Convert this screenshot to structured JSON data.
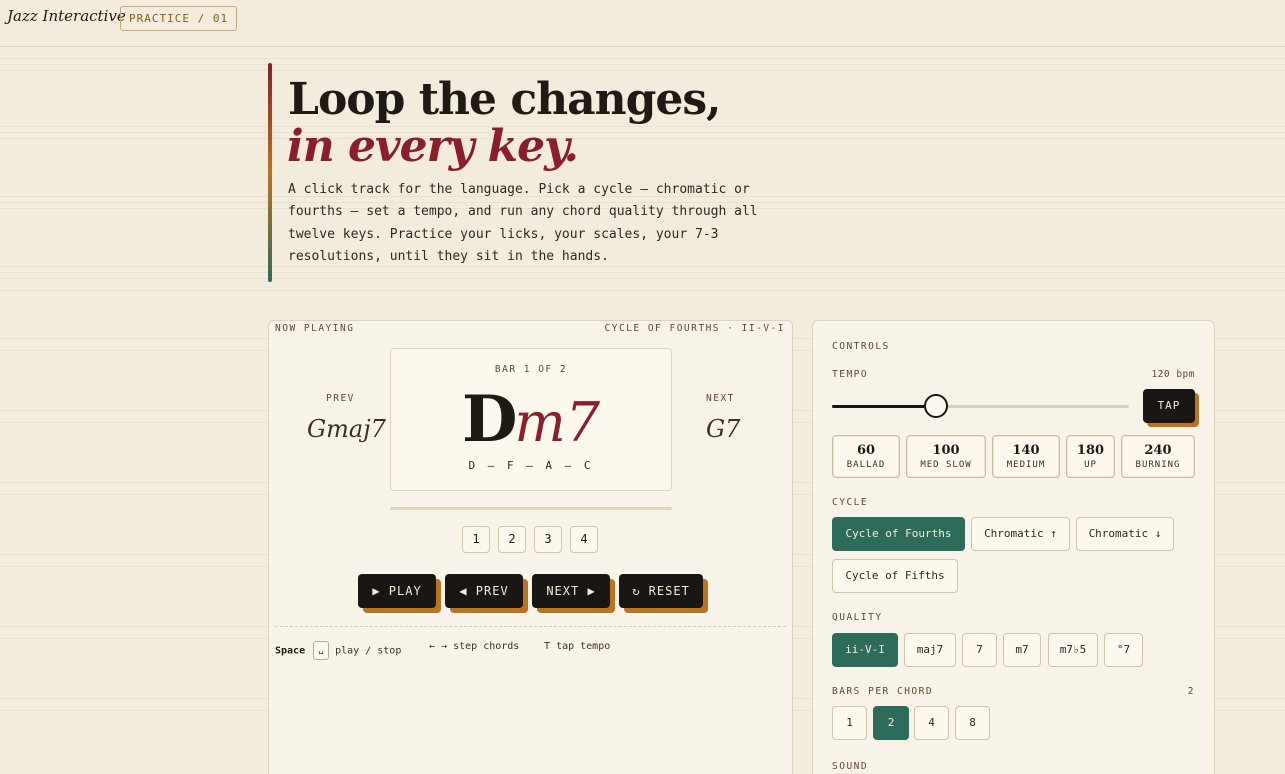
{
  "header": {
    "brand": "Jazz Interactive",
    "crumb": "PRACTICE / 01"
  },
  "hero": {
    "title_line1": "Loop the changes,",
    "title_line2": "in every key.",
    "description": "A click track for the language. Pick a cycle — chromatic or fourths — set a tempo, and run any chord quality through all twelve keys. Practice your licks, your scales, your 7-3 resolutions, until they sit in the hands."
  },
  "now_playing": {
    "label": "NOW PLAYING",
    "context": "CYCLE OF FOURTHS · II-V-I",
    "bar_label": "BAR 1 OF 2",
    "current_root": "D",
    "current_quality": "m7",
    "notes": "D – F – A – C",
    "prev_label": "PREV",
    "prev_chord": "Gmaj7",
    "next_label": "NEXT",
    "next_chord": "G7",
    "beats": [
      "1",
      "2",
      "3",
      "4"
    ],
    "buttons": {
      "play": "PLAY",
      "prev": "PREV",
      "next": "NEXT",
      "reset": "RESET"
    },
    "shortcuts": {
      "space_key": "Space",
      "space_cap": "␣",
      "space_desc": "play / stop",
      "arrows": "← →",
      "arrows_desc": "step chords",
      "tap_key": "T",
      "tap_desc": "tap tempo"
    }
  },
  "controls": {
    "label": "CONTROLS",
    "tempo_label": "TEMPO",
    "tempo_value": "120 bpm",
    "tempo_bpm": 120,
    "tempo_fraction": 0.35,
    "tap_label": "TAP",
    "presets": [
      {
        "bpm": "60",
        "name": "BALLAD"
      },
      {
        "bpm": "100",
        "name": "MED SLOW"
      },
      {
        "bpm": "140",
        "name": "MEDIUM"
      },
      {
        "bpm": "180",
        "name": "UP"
      },
      {
        "bpm": "240",
        "name": "BURNING"
      }
    ],
    "cycle_label": "CYCLE",
    "cycles": [
      "Cycle of Fourths",
      "Chromatic ↑",
      "Chromatic ↓",
      "Cycle of Fifths"
    ],
    "cycle_selected": "Cycle of Fourths",
    "quality_label": "QUALITY",
    "qualities": [
      "ii-V-I",
      "maj7",
      "7",
      "m7",
      "m7♭5",
      "°7"
    ],
    "quality_selected": "ii-V-I",
    "bars_label": "BARS PER CHORD",
    "bars_value": "2",
    "bars_options": [
      "1",
      "2",
      "4",
      "8"
    ],
    "bars_selected": "2",
    "sound_label": "SOUND"
  },
  "colors": {
    "accent_red": "#8a1f2b",
    "accent_orange": "#b9741d",
    "accent_green": "#2d6b5a",
    "ink": "#1a1613",
    "paper": "#f3ecdc"
  }
}
